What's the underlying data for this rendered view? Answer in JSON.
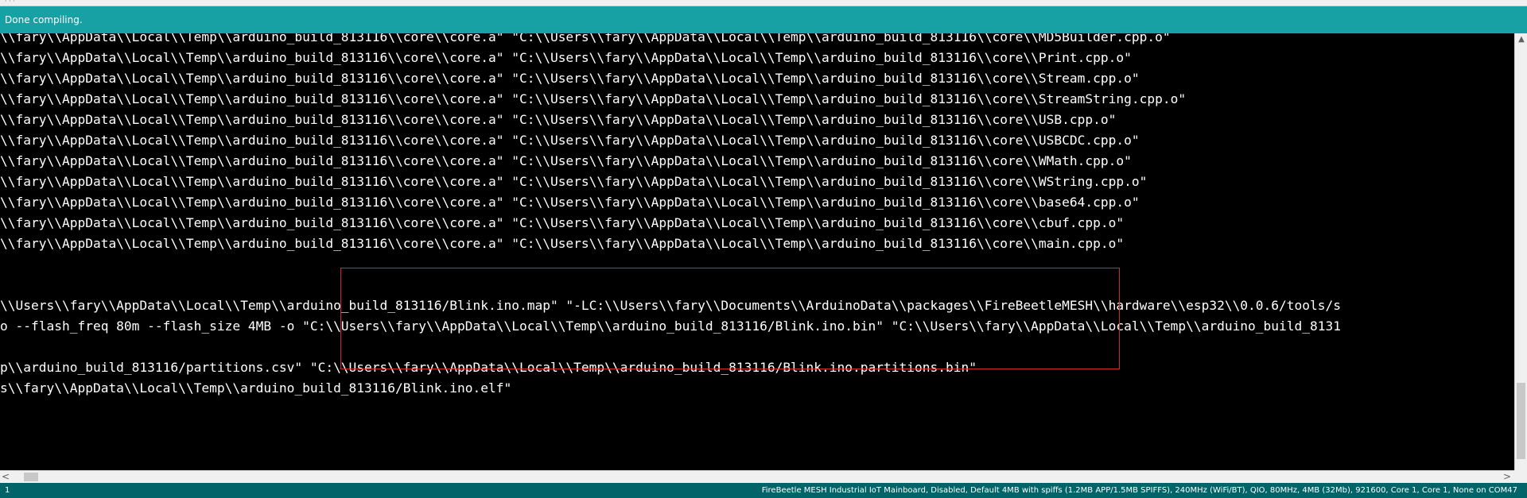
{
  "window": {
    "top_strip_glyph": "· · ·"
  },
  "status_bar": {
    "message": "Done compiling."
  },
  "console": {
    "lines": [
      "\\\\fary\\\\AppData\\\\Local\\\\Temp\\\\arduino_build_813116\\\\core\\\\core.a\" \"C:\\\\Users\\\\fary\\\\AppData\\\\Local\\\\Temp\\\\arduino_build_813116\\\\core\\\\MD5Builder.cpp.o\"",
      "\\\\fary\\\\AppData\\\\Local\\\\Temp\\\\arduino_build_813116\\\\core\\\\core.a\" \"C:\\\\Users\\\\fary\\\\AppData\\\\Local\\\\Temp\\\\arduino_build_813116\\\\core\\\\Print.cpp.o\"",
      "\\\\fary\\\\AppData\\\\Local\\\\Temp\\\\arduino_build_813116\\\\core\\\\core.a\" \"C:\\\\Users\\\\fary\\\\AppData\\\\Local\\\\Temp\\\\arduino_build_813116\\\\core\\\\Stream.cpp.o\"",
      "\\\\fary\\\\AppData\\\\Local\\\\Temp\\\\arduino_build_813116\\\\core\\\\core.a\" \"C:\\\\Users\\\\fary\\\\AppData\\\\Local\\\\Temp\\\\arduino_build_813116\\\\core\\\\StreamString.cpp.o\"",
      "\\\\fary\\\\AppData\\\\Local\\\\Temp\\\\arduino_build_813116\\\\core\\\\core.a\" \"C:\\\\Users\\\\fary\\\\AppData\\\\Local\\\\Temp\\\\arduino_build_813116\\\\core\\\\USB.cpp.o\"",
      "\\\\fary\\\\AppData\\\\Local\\\\Temp\\\\arduino_build_813116\\\\core\\\\core.a\" \"C:\\\\Users\\\\fary\\\\AppData\\\\Local\\\\Temp\\\\arduino_build_813116\\\\core\\\\USBCDC.cpp.o\"",
      "\\\\fary\\\\AppData\\\\Local\\\\Temp\\\\arduino_build_813116\\\\core\\\\core.a\" \"C:\\\\Users\\\\fary\\\\AppData\\\\Local\\\\Temp\\\\arduino_build_813116\\\\core\\\\WMath.cpp.o\"",
      "\\\\fary\\\\AppData\\\\Local\\\\Temp\\\\arduino_build_813116\\\\core\\\\core.a\" \"C:\\\\Users\\\\fary\\\\AppData\\\\Local\\\\Temp\\\\arduino_build_813116\\\\core\\\\WString.cpp.o\"",
      "\\\\fary\\\\AppData\\\\Local\\\\Temp\\\\arduino_build_813116\\\\core\\\\core.a\" \"C:\\\\Users\\\\fary\\\\AppData\\\\Local\\\\Temp\\\\arduino_build_813116\\\\core\\\\base64.cpp.o\"",
      "\\\\fary\\\\AppData\\\\Local\\\\Temp\\\\arduino_build_813116\\\\core\\\\core.a\" \"C:\\\\Users\\\\fary\\\\AppData\\\\Local\\\\Temp\\\\arduino_build_813116\\\\core\\\\cbuf.cpp.o\"",
      "\\\\fary\\\\AppData\\\\Local\\\\Temp\\\\arduino_build_813116\\\\core\\\\core.a\" \"C:\\\\Users\\\\fary\\\\AppData\\\\Local\\\\Temp\\\\arduino_build_813116\\\\core\\\\main.cpp.o\"",
      "",
      "",
      "\\\\Users\\\\fary\\\\AppData\\\\Local\\\\Temp\\\\arduino_build_813116/Blink.ino.map\" \"-LC:\\\\Users\\\\fary\\\\Documents\\\\ArduinoData\\\\packages\\\\FireBeetleMESH\\\\hardware\\\\esp32\\\\0.0.6/tools/s",
      "o --flash_freq 80m --flash_size 4MB -o \"C:\\\\Users\\\\fary\\\\AppData\\\\Local\\\\Temp\\\\arduino_build_813116/Blink.ino.bin\" \"C:\\\\Users\\\\fary\\\\AppData\\\\Local\\\\Temp\\\\arduino_build_8131",
      "",
      "p\\\\arduino_build_813116/partitions.csv\" \"C:\\\\Users\\\\fary\\\\AppData\\\\Local\\\\Temp\\\\arduino_build_813116/Blink.ino.partitions.bin\"",
      "s\\\\fary\\\\AppData\\\\Local\\\\Temp\\\\arduino_build_813116/Blink.ino.elf\""
    ]
  },
  "scrollbars": {
    "up_arrow": "▲",
    "left_arrow": "<",
    "right_arrow": ">"
  },
  "footer": {
    "line_number": "1",
    "board_info": "FireBeetle MESH Industrial IoT Mainboard, Disabled, Default 4MB with spiffs (1.2MB APP/1.5MB SPIFFS), 240MHz (WiFi/BT), QIO, 80MHz, 4MB (32Mb), 921600, Core 1, Core 1, None on COM47"
  },
  "colors": {
    "status_bar": "#17a1a5",
    "footer_bar": "#006468",
    "console_bg": "#000000",
    "console_text": "#ffffff",
    "highlight_border": "#cc2b2b"
  }
}
